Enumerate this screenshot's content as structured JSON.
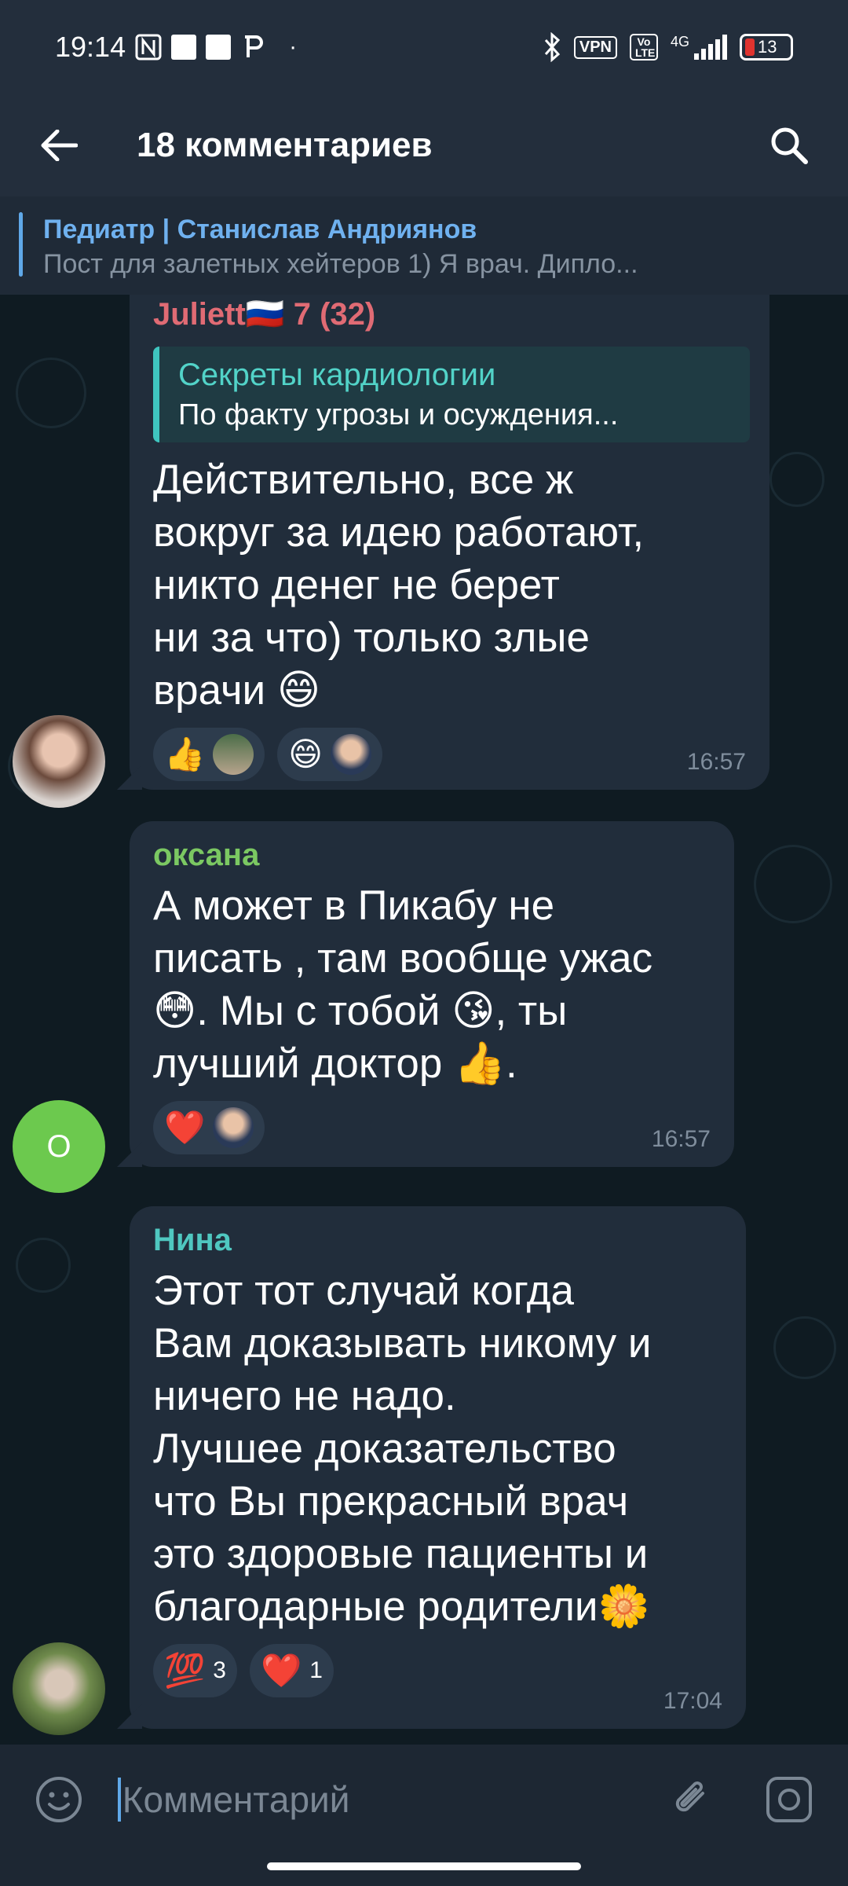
{
  "status_bar": {
    "time": "19:14",
    "left_icons": [
      "nfc-icon",
      "notification-box-icon",
      "notification-box-icon",
      "p-app-icon",
      "dot-icon"
    ],
    "vpn": "VPN",
    "volte": "Vo LTE",
    "network": "4G",
    "battery": "13"
  },
  "app_bar": {
    "title": "18 комментариев"
  },
  "pinned": {
    "title": "Педиатр | Станислав Андриянов",
    "text": "Пост для залетных хейтеров  1) Я врач. Дипло..."
  },
  "messages": [
    {
      "author": "Juliett🇷🇺 7 (32)",
      "author_color": "#e06b74",
      "reply_title": "Секреты кардиологии",
      "reply_text": "По факту угрозы и осуждения...",
      "text": "Действительно, все ж\nвокруг за идею работают,\nникто денег не берет\nни за что) только злые\nврачи 😄",
      "reactions": [
        {
          "emoji": "👍",
          "avatar": "user-avatar"
        },
        {
          "emoji": "😄",
          "avatar": "user-avatar"
        }
      ],
      "time": "16:57"
    },
    {
      "author": "оксана",
      "author_color": "#7bc862",
      "text": "А может в Пикабу не\nписать , там вообще ужас\n😳. Мы с тобой 😘, ты\nлучший доктор 👍.",
      "reactions": [
        {
          "emoji": "❤️",
          "avatar": "user-avatar"
        }
      ],
      "avatar_letter": "О",
      "time": "16:57"
    },
    {
      "author": "Нина",
      "author_color": "#4fc7c0",
      "text": "Этот тот случай когда\nВам доказывать никому и\nничего не надо.\nЛучшее доказательство\nчто Вы прекрасный врач\nэто здоровые пациенты и\nблагодарные родители🌼",
      "reactions": [
        {
          "emoji": "💯",
          "count": "3"
        },
        {
          "emoji": "❤️",
          "count": "1"
        }
      ],
      "time": "17:04"
    }
  ],
  "input": {
    "placeholder": "Комментарий"
  },
  "colors": {
    "accent": "#5fa8e8",
    "bubble": "#212d3b",
    "background": "#0f1b22"
  }
}
